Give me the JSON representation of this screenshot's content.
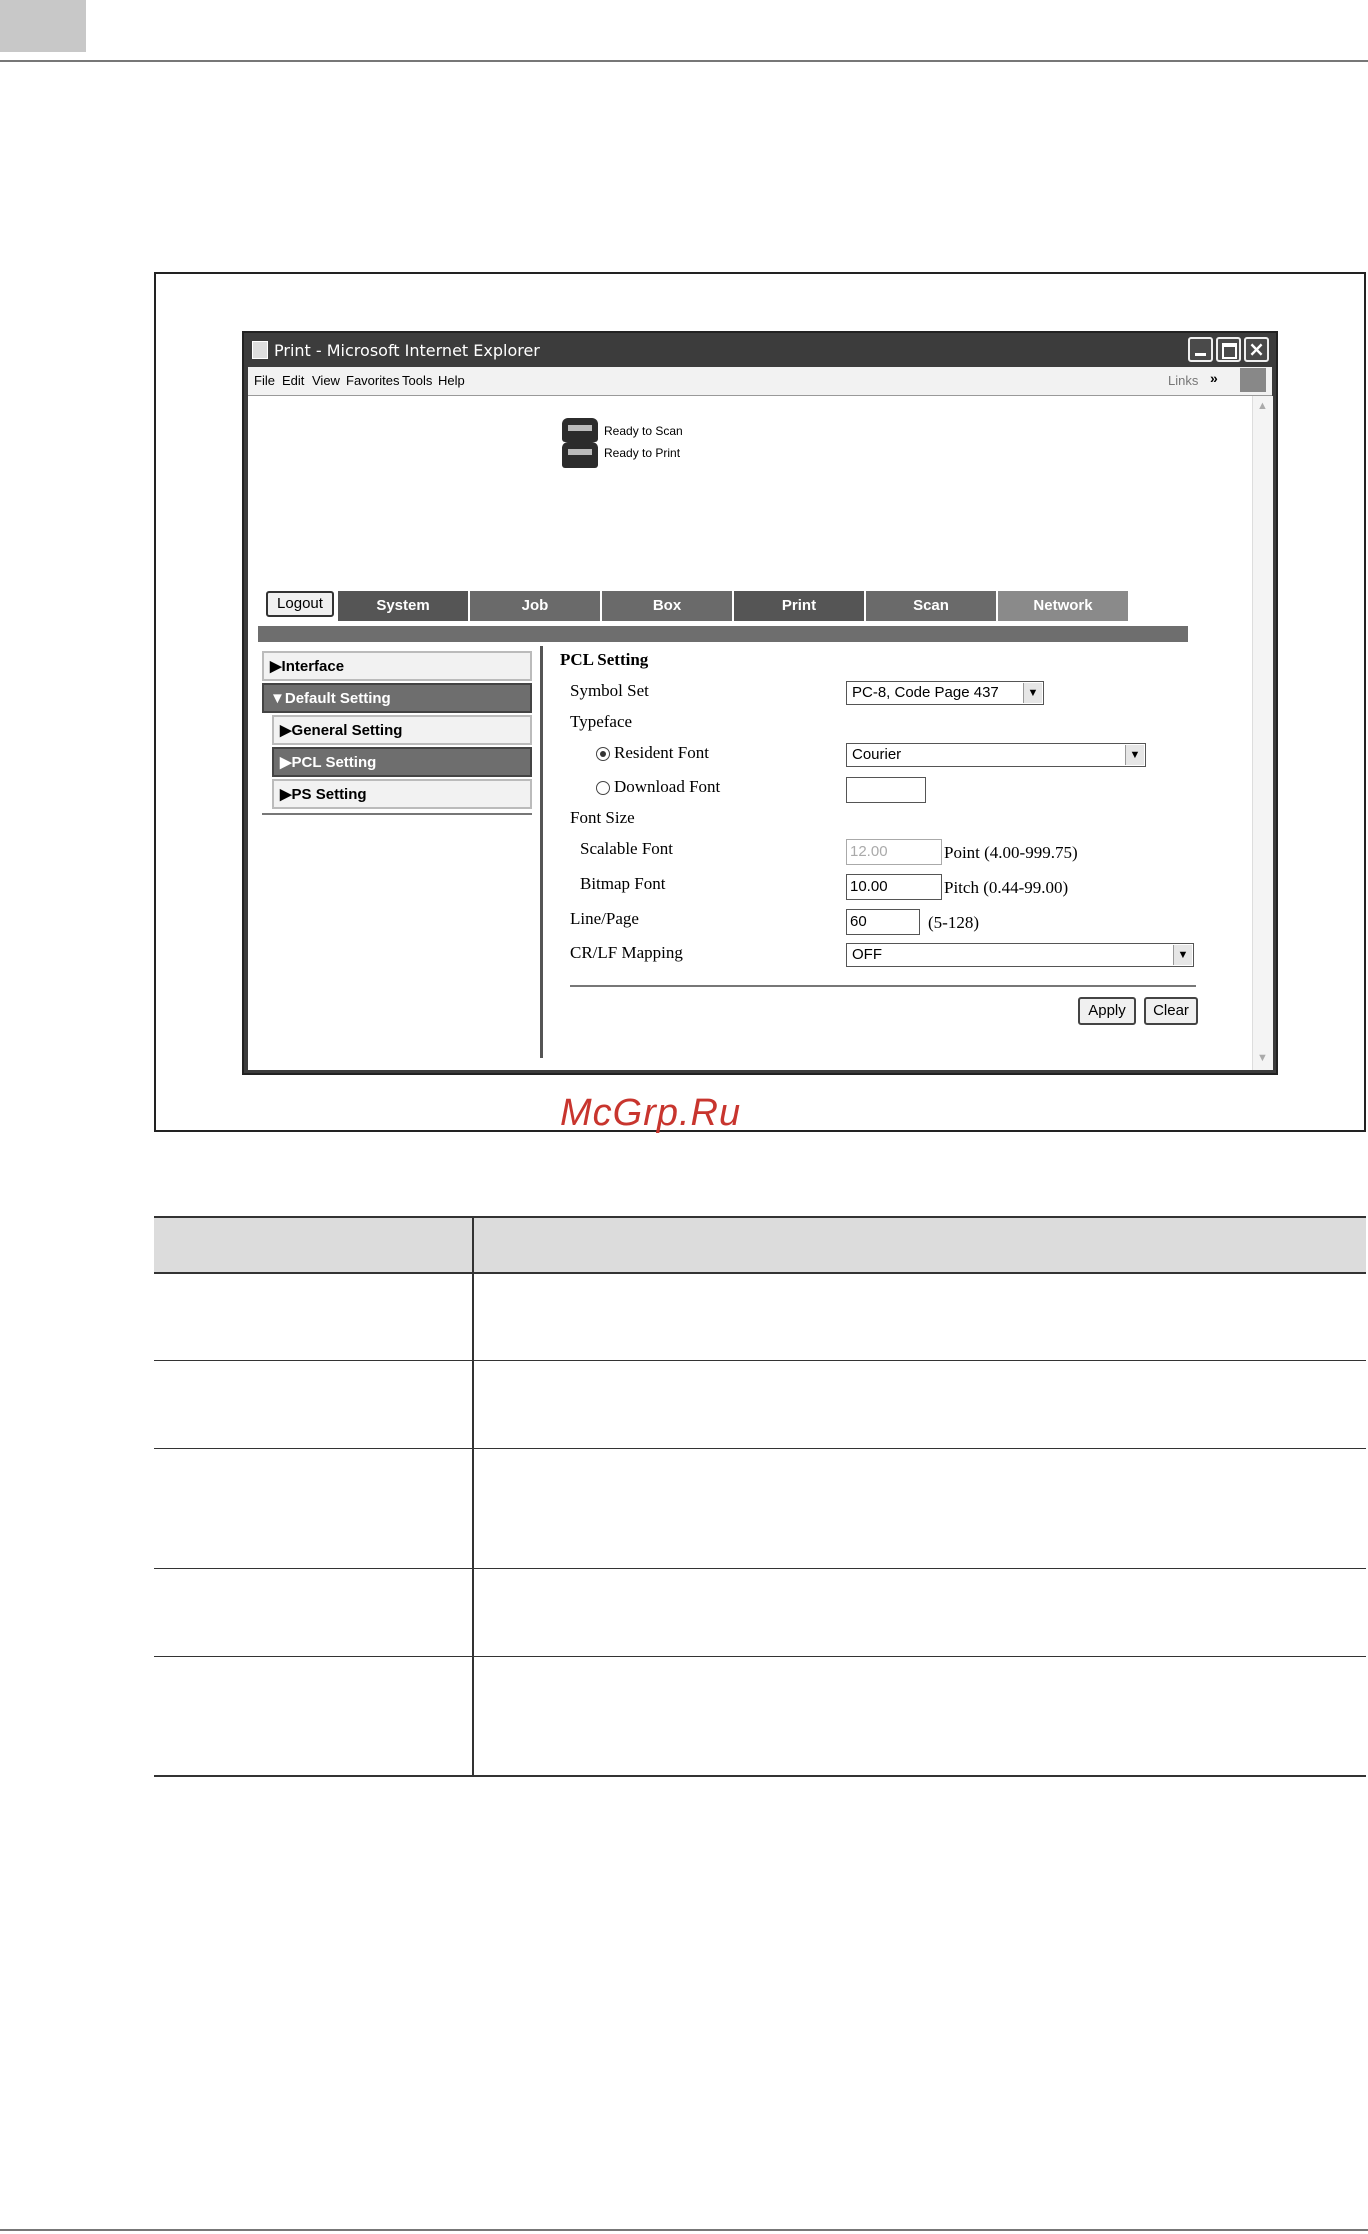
{
  "window": {
    "title": "Print - Microsoft Internet Explorer"
  },
  "menu": [
    "File",
    "Edit",
    "View",
    "Favorites",
    "Tools",
    "Help"
  ],
  "toolbar": {
    "links_label": "Links",
    "chevron": "»"
  },
  "status": {
    "scan": "Ready to Scan",
    "print": "Ready to Print"
  },
  "logout_label": "Logout",
  "tabs": [
    "System",
    "Job",
    "Box",
    "Print",
    "Scan",
    "Network"
  ],
  "nav": [
    "Interface",
    "Default Setting",
    "General Setting",
    "PCL Setting",
    "PS Setting"
  ],
  "nav_markers": {
    "closed": "▶",
    "open": "▼"
  },
  "form": {
    "title": "PCL Setting",
    "symbol_set_label": "Symbol Set",
    "symbol_set_value": "PC-8, Code Page 437",
    "typeface_label": "Typeface",
    "resident_font_label": "Resident Font",
    "resident_font_value": "Courier",
    "download_font_label": "Download Font",
    "download_font_value": "",
    "font_size_label": "Font Size",
    "scalable_font_label": "Scalable Font",
    "scalable_font_value": "12.00",
    "scalable_font_range": "Point (4.00-999.75)",
    "bitmap_font_label": "Bitmap Font",
    "bitmap_font_value": "10.00",
    "bitmap_font_range": "Pitch (0.44-99.00)",
    "line_page_label": "Line/Page",
    "line_page_value": "60",
    "line_page_range": "(5-128)",
    "crlf_label": "CR/LF Mapping",
    "crlf_value": "OFF",
    "apply_label": "Apply",
    "clear_label": "Clear"
  },
  "watermark": "McGrp.Ru",
  "icons": {
    "dropdown": "dropdown-arrow-icon",
    "close": "close-icon",
    "minimize": "minimize-icon",
    "maximize": "maximize-icon"
  }
}
